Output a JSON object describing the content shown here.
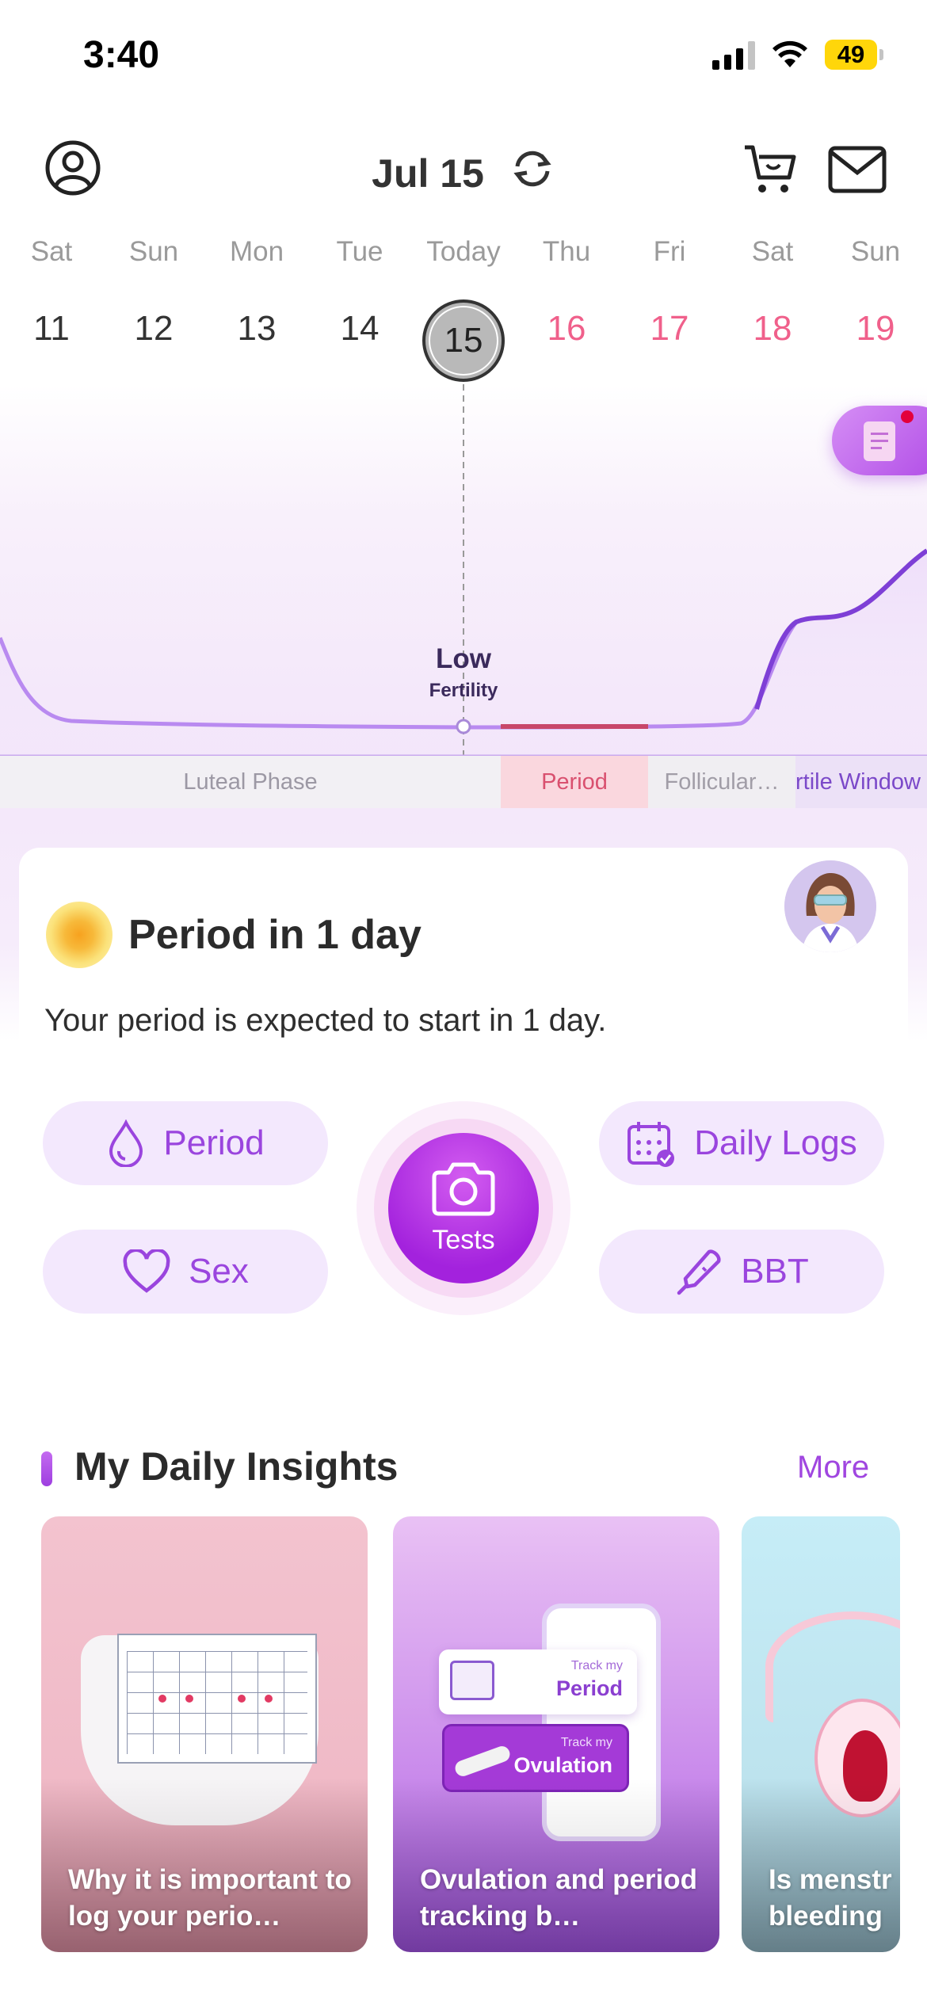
{
  "status_bar": {
    "time": "3:40",
    "battery": "49"
  },
  "header": {
    "date": "Jul 15"
  },
  "week": [
    {
      "name": "Sat",
      "num": "11"
    },
    {
      "name": "Sun",
      "num": "12"
    },
    {
      "name": "Mon",
      "num": "13"
    },
    {
      "name": "Tue",
      "num": "14"
    },
    {
      "name": "Today",
      "num": "15"
    },
    {
      "name": "Thu",
      "num": "16"
    },
    {
      "name": "Fri",
      "num": "17"
    },
    {
      "name": "Sat",
      "num": "18"
    },
    {
      "name": "Sun",
      "num": "19"
    }
  ],
  "fertility": {
    "level": "Low",
    "label": "Fertility"
  },
  "phases": {
    "luteal": "Luteal Phase",
    "period": "Period",
    "follicular": "Follicular…",
    "fertile": "rtile Window"
  },
  "period_card": {
    "title": "Period in 1 day",
    "subtitle": "Your period is expected to start in 1 day.",
    "actions": {
      "period": "Period",
      "sex": "Sex",
      "tests": "Tests",
      "daily_logs": "Daily Logs",
      "bbt": "BBT"
    }
  },
  "insights": {
    "title": "My Daily Insights",
    "more": "More",
    "tiles": [
      {
        "caption": "Why it is important to log your perio…"
      },
      {
        "caption": "Ovulation and period tracking b…",
        "track_small_1": "Track my",
        "track_big_1": "Period",
        "track_small_2": "Track my",
        "track_big_2": "Ovulation"
      },
      {
        "caption_line1": "Is menstr",
        "caption_line2": "bleeding"
      }
    ]
  },
  "colors": {
    "accent": "#9a45de",
    "period_pink": "#f0608b",
    "curve": "#b98af0"
  }
}
